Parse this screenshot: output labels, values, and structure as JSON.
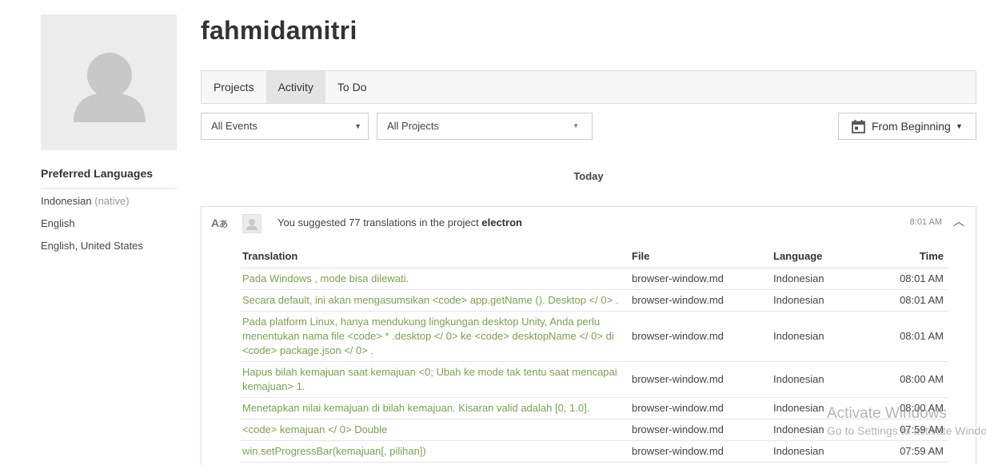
{
  "profile": {
    "username": "fahmidamitri",
    "preferred_languages_title": "Preferred Languages",
    "languages": [
      {
        "name": "Indonesian",
        "note": "(native)"
      },
      {
        "name": "English",
        "note": ""
      },
      {
        "name": "English, United States",
        "note": ""
      }
    ]
  },
  "tabs": [
    {
      "label": "Projects",
      "active": false
    },
    {
      "label": "Activity",
      "active": true
    },
    {
      "label": "To Do",
      "active": false
    }
  ],
  "filters": {
    "events": {
      "value": "All Events"
    },
    "projects": {
      "value": "All Projects"
    },
    "date": {
      "label": "From Beginning",
      "icon": "calendar-icon"
    }
  },
  "activity": {
    "day_heading": "Today",
    "summary_prefix": "You suggested 77 translations in the project",
    "project": "electron",
    "time": "8:01 AM",
    "columns": {
      "translation": "Translation",
      "file": "File",
      "language": "Language",
      "time": "Time"
    },
    "rows": [
      {
        "translation": "Pada Windows , mode bisa dilewati.",
        "file": "browser-window.md",
        "language": "Indonesian",
        "time": "08:01 AM"
      },
      {
        "translation": "Secara default, ini akan mengasumsikan <code> app.getName (). Desktop </ 0> .",
        "file": "browser-window.md",
        "language": "Indonesian",
        "time": "08:01 AM"
      },
      {
        "translation": "Pada platform Linux, hanya mendukung lingkungan desktop Unity, Anda perlu menentukan nama file <code> * .desktop </ 0> ke <code> desktopName </ 0> di <code> package.json </ 0> .",
        "file": "browser-window.md",
        "language": "Indonesian",
        "time": "08:01 AM"
      },
      {
        "translation": "Hapus bilah kemajuan saat kemajuan <0; Ubah ke mode tak tentu saat mencapai kemajuan> 1.",
        "file": "browser-window.md",
        "language": "Indonesian",
        "time": "08:00 AM"
      },
      {
        "translation": "Menetapkan nilai kemajuan di bilah kemajuan. Kisaran valid adalah [0, 1.0].",
        "file": "browser-window.md",
        "language": "Indonesian",
        "time": "08:00 AM"
      },
      {
        "translation": "<code> kemajuan </ 0> Double",
        "file": "browser-window.md",
        "language": "Indonesian",
        "time": "07:59 AM"
      },
      {
        "translation": "win.setProgressBar(kemajuan[, pilihan])",
        "file": "browser-window.md",
        "language": "Indonesian",
        "time": "07:59 AM"
      }
    ]
  },
  "watermark": {
    "line1": "Activate Windows",
    "line2": "Go to Settings to activate Windows."
  }
}
